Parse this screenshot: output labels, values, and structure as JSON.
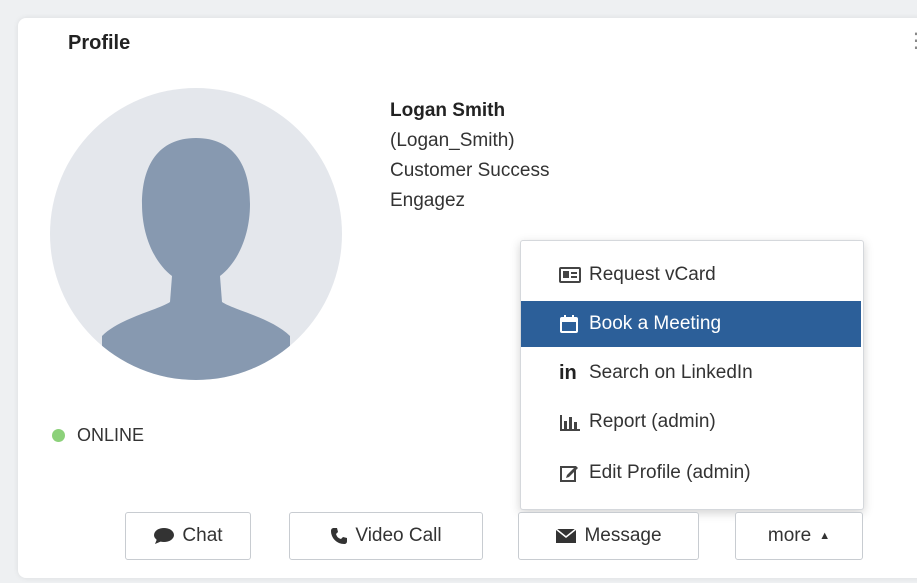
{
  "profile": {
    "title": "Profile",
    "name": "Logan Smith",
    "username": "(Logan_Smith)",
    "department": "Customer Success",
    "company": "Engagez",
    "status": "ONLINE"
  },
  "actions": {
    "chat": "Chat",
    "video_call": "Video Call",
    "message": "Message",
    "more": "more"
  },
  "more_menu": {
    "items": [
      {
        "label": "Request vCard",
        "icon": "vcard-icon"
      },
      {
        "label": "Book a Meeting",
        "icon": "calendar-icon"
      },
      {
        "label": "Search on LinkedIn",
        "icon": "linkedin-icon",
        "glyph": "in"
      },
      {
        "label": "Report (admin)",
        "icon": "bar-chart-icon"
      },
      {
        "label": "Edit Profile (admin)",
        "icon": "edit-icon"
      }
    ],
    "highlighted": "Book a Meeting"
  },
  "colors": {
    "highlight": "#2c5f99",
    "online": "#8cd17a",
    "avatar_bg": "#e4e7ec",
    "avatar_figure": "#8799b0"
  }
}
